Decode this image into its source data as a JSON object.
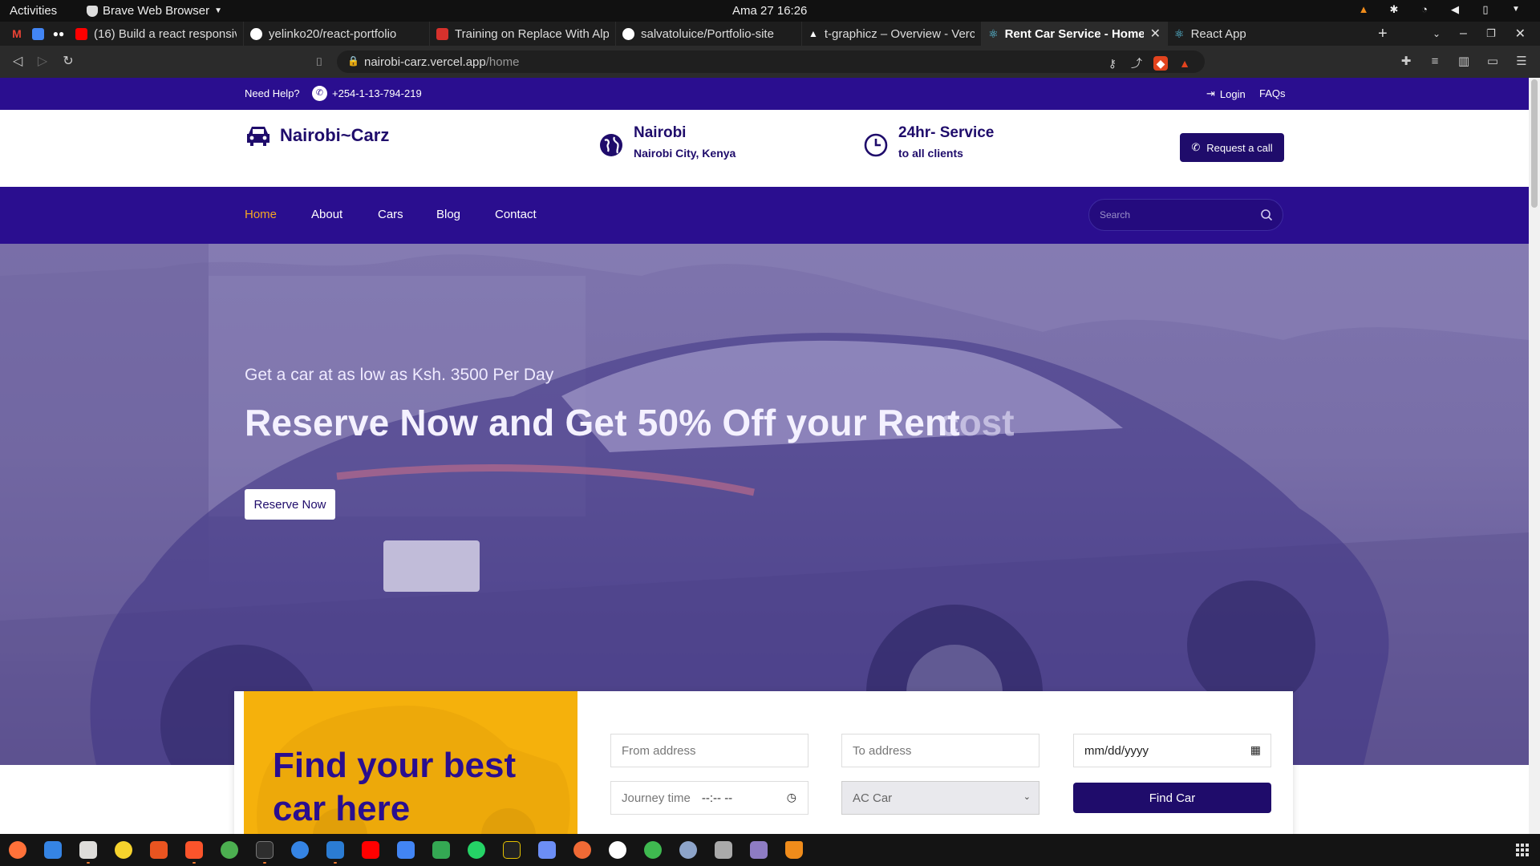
{
  "system": {
    "activities": "Activities",
    "app_name": "Brave Web Browser",
    "clock": "Ama 27  16:26"
  },
  "tabs": [
    {
      "title": "(16) Build a react responsive",
      "favicon_color": "#ff0000",
      "favicon": "youtube-icon"
    },
    {
      "title": "yelinko20/react-portfolio",
      "favicon_color": "#ffffff",
      "favicon": "github-icon"
    },
    {
      "title": "Training on Replace With Alp",
      "favicon_color": "#d6312c",
      "favicon": "training-icon"
    },
    {
      "title": "salvatoluice/Portfolio-site",
      "favicon_color": "#ffffff",
      "favicon": "github-icon"
    },
    {
      "title": "t-graphicz – Overview - Verce",
      "favicon_color": "#ffffff",
      "favicon": "vercel-icon"
    },
    {
      "title": "Rent Car Service - Home",
      "favicon_color": "#61dafb",
      "favicon": "react-icon",
      "active": true
    },
    {
      "title": "React App",
      "favicon_color": "#61dafb",
      "favicon": "react-icon"
    }
  ],
  "address": {
    "host": "nairobi-carz.vercel.app",
    "path": "/home"
  },
  "site": {
    "topbar": {
      "need_help": "Need Help?",
      "phone": "+254-1-13-794-219",
      "login": "Login",
      "faqs": "FAQs"
    },
    "brand": "Nairobi~Carz",
    "location": {
      "title": "Nairobi",
      "subtitle": "Nairobi City, Kenya"
    },
    "service": {
      "title": "24hr- Service",
      "subtitle": "to all clients"
    },
    "request_call": "Request a call",
    "nav": [
      "Home",
      "About",
      "Cars",
      "Blog",
      "Contact"
    ],
    "search_placeholder": "Search",
    "hero": {
      "tagline": "Get a car at as low as Ksh. 3500 Per Day",
      "headline": "Reserve Now and Get 50% Off your Rent",
      "ghost_word": "cost",
      "cta": "Reserve Now"
    },
    "booking": {
      "title": "Find your best car here",
      "from_placeholder": "From address",
      "to_placeholder": "To address",
      "date_placeholder": "mm/dd/yyyy",
      "journey_time_label": "Journey time",
      "time_placeholder": "--:-- --",
      "car_type": "AC Car",
      "submit": "Find Car"
    }
  },
  "colors": {
    "primary_purple": "#2a0e8f",
    "dark_purple": "#1f0c6b",
    "accent_orange": "#f4a623",
    "booking_yellow": "#f5b10c"
  }
}
